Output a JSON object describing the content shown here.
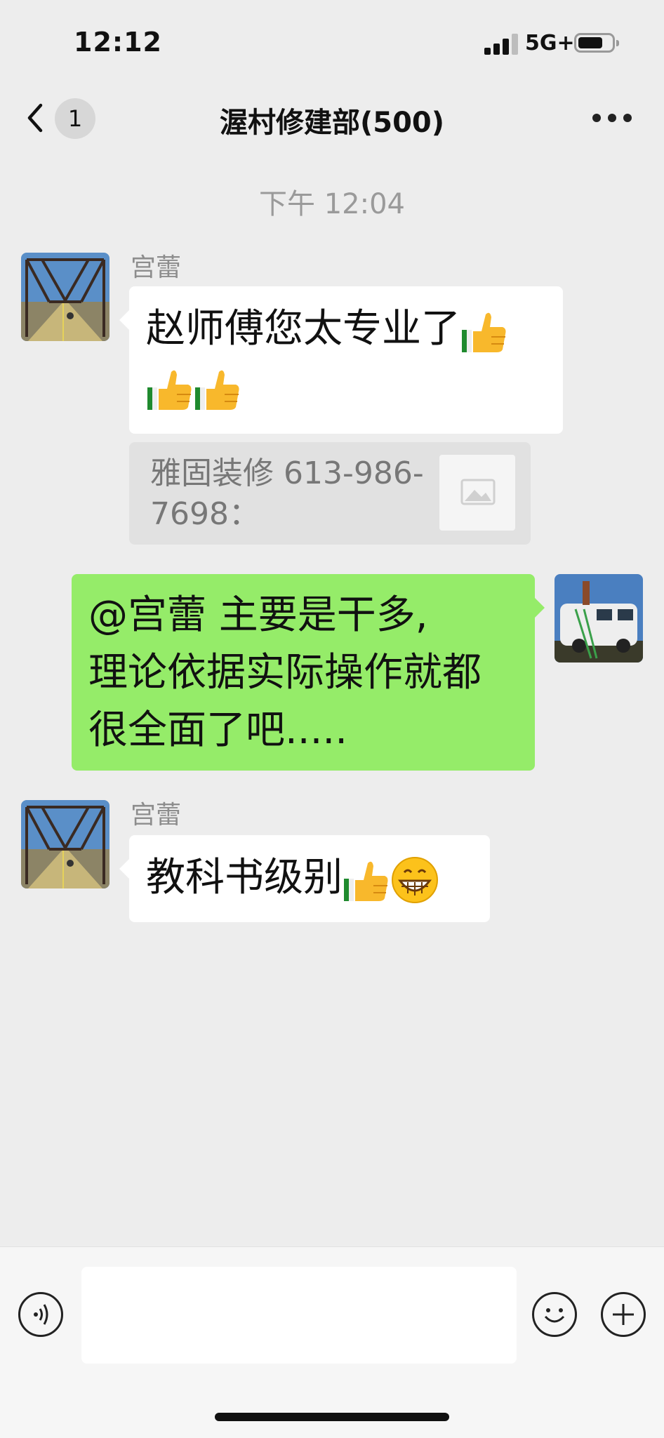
{
  "status_bar": {
    "time": "12:12",
    "network": "5G+",
    "battery_level": 0.7
  },
  "nav": {
    "unread_count": "1",
    "title": "渥村修建部(500)"
  },
  "chat": {
    "timestamp": "下午 12:04",
    "messages": [
      {
        "from": "other",
        "sender": "宫蕾",
        "line1": "赵师傅您太专业了",
        "icons": [
          "thumbs-up-icon",
          "thumbs-up-icon",
          "thumbs-up-icon"
        ]
      },
      {
        "type": "quote",
        "quote_line1": "雅固装修 613-986-",
        "quote_line2": "7698：",
        "thumb": "image-placeholder-icon"
      },
      {
        "from": "me",
        "line1": "@宫蕾 主要是干多,",
        "line2": "理论依据实际操作就都",
        "line3": "很全面了吧....."
      },
      {
        "from": "other",
        "sender": "宫蕾",
        "line1": "教科书级别",
        "icons": [
          "thumbs-up-icon",
          "grinning-face-icon"
        ]
      }
    ]
  },
  "input_bar": {
    "voice_icon": "voice-icon",
    "emoji_icon": "emoji-icon",
    "more_icon": "plus-icon",
    "placeholder": ""
  }
}
